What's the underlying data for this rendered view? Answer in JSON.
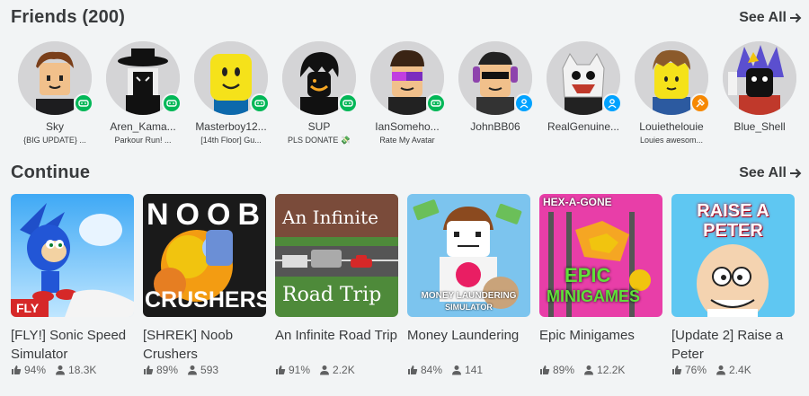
{
  "friends": {
    "title": "Friends (200)",
    "see_all": "See All",
    "items": [
      {
        "name": "Sky",
        "status": "{BIG UPDATE} ...",
        "presence": "game",
        "color": "#02b757"
      },
      {
        "name": "Aren_Kama...",
        "status": "Parkour Run! ...",
        "presence": "game",
        "color": "#02b757"
      },
      {
        "name": "Masterboy12...",
        "status": "[14th Floor] Gu...",
        "presence": "game",
        "color": "#02b757"
      },
      {
        "name": "SUP",
        "status": "PLS DONATE 💸",
        "presence": "game",
        "color": "#02b757"
      },
      {
        "name": "IanSomeho...",
        "status": "Rate My Avatar",
        "presence": "game",
        "color": "#02b757"
      },
      {
        "name": "JohnBB06",
        "status": "",
        "presence": "online",
        "color": "#00a2ff"
      },
      {
        "name": "RealGenuine...",
        "status": "",
        "presence": "online",
        "color": "#00a2ff"
      },
      {
        "name": "Louiethelouie",
        "status": "Louies awesom...",
        "presence": "studio",
        "color": "#f68802"
      },
      {
        "name": "Blue_Shell",
        "status": "",
        "presence": "none",
        "color": ""
      }
    ]
  },
  "continue": {
    "title": "Continue",
    "see_all": "See All",
    "games": [
      {
        "title": "[FLY!] Sonic Speed Simulator",
        "rating": "94%",
        "players": "18.3K"
      },
      {
        "title": "[SHREK] Noob Crushers",
        "rating": "89%",
        "players": "593"
      },
      {
        "title": "An Infinite Road Trip",
        "rating": "91%",
        "players": "2.2K"
      },
      {
        "title": "Money Laundering",
        "rating": "84%",
        "players": "141"
      },
      {
        "title": "Epic Minigames",
        "rating": "89%",
        "players": "12.2K"
      },
      {
        "title": "[Update 2] Raise a Peter",
        "rating": "76%",
        "players": "2.4K"
      }
    ]
  },
  "thumb_text": {
    "sonic_badge": "FLY",
    "noob": "NOOB",
    "crushers": "CRUSHERS",
    "road_top": "An Infinite",
    "road_bottom": "Road Trip",
    "money_caption": "MONEY LAUNDERING",
    "money_caption2": "SIMULATOR",
    "hex": "HEX-A-GONE",
    "epic": "EPIC",
    "minigames": "MINIGAMES",
    "raise_a": "RAISE A",
    "peter": "PETER"
  }
}
